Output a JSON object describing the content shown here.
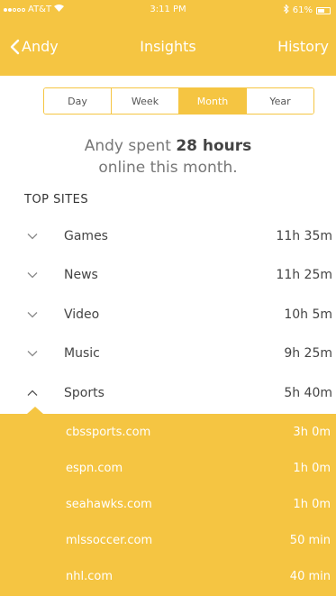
{
  "status_bar": {
    "carrier": "AT&T",
    "time": "3:11 PM",
    "battery": "61%",
    "battery_level": 0.61
  },
  "nav": {
    "back_label": "Andy",
    "title": "Insights",
    "right_label": "History"
  },
  "periods": [
    {
      "label": "Day"
    },
    {
      "label": "Week"
    },
    {
      "label": "Month"
    },
    {
      "label": "Year"
    }
  ],
  "selected_period": "Month",
  "summary": {
    "prefix": "Andy spent ",
    "hours": "28 hours",
    "suffix": "online this month."
  },
  "section_title": "TOP SITES",
  "categories": [
    {
      "name": "Games",
      "time": "11h 35m",
      "expanded": false
    },
    {
      "name": "News",
      "time": "11h 25m",
      "expanded": false
    },
    {
      "name": "Video",
      "time": "10h 5m",
      "expanded": false
    },
    {
      "name": "Music",
      "time": "9h 25m",
      "expanded": false
    },
    {
      "name": "Sports",
      "time": "5h 40m",
      "expanded": true
    }
  ],
  "sports_sites": [
    {
      "site": "cbssports.com",
      "time": "3h 0m"
    },
    {
      "site": "espn.com",
      "time": "1h 0m"
    },
    {
      "site": "seahawks.com",
      "time": "1h 0m"
    },
    {
      "site": "mlssoccer.com",
      "time": "50 min"
    },
    {
      "site": "nhl.com",
      "time": "40 min"
    }
  ],
  "colors": {
    "accent": "#f5c542",
    "text": "#444444"
  },
  "icons": {
    "collapsed": "chevron-down-icon",
    "expanded": "chevron-up-icon",
    "back": "chevron-left-icon"
  }
}
